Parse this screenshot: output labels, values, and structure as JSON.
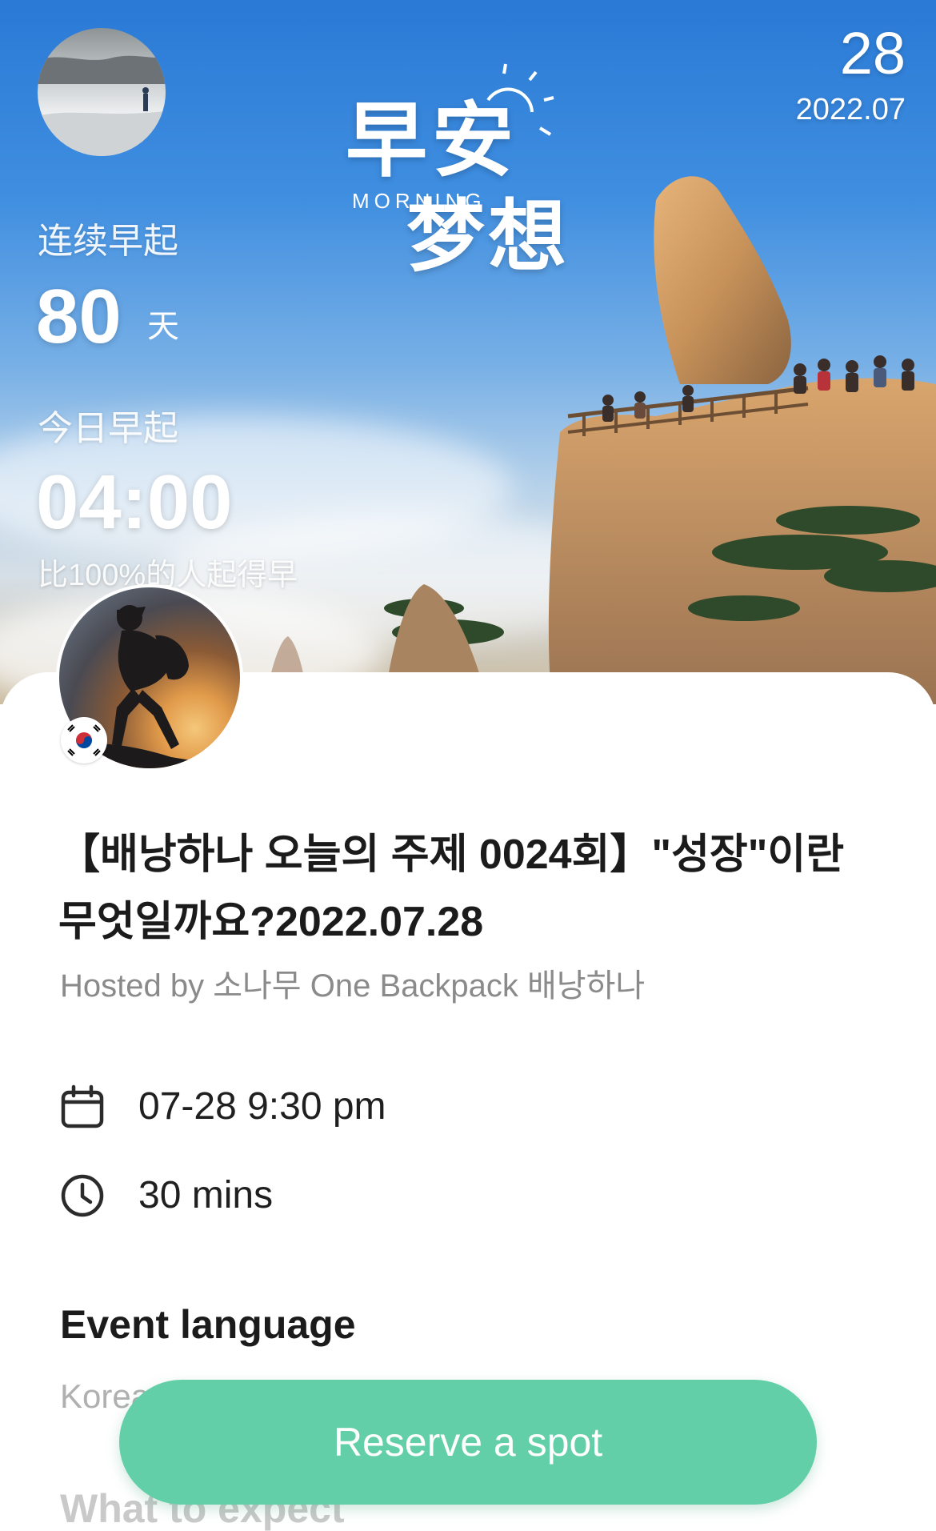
{
  "hero": {
    "date_day": "28",
    "date_month": "2022.07",
    "logo_cn_top": "早安",
    "logo_en": "MORNING",
    "logo_cn_bottom": "梦想",
    "streak_label": "连续早起",
    "streak_value": "80",
    "streak_unit": "天",
    "today_label": "今日早起",
    "today_time": "04:00",
    "ranking_text": "比100%的人起得早"
  },
  "event": {
    "title": "【배낭하나 오늘의 주제 0024회】\"성장\"이란 무엇일까요?2022.07.28",
    "hosted_by": "Hosted by 소나무 One Backpack 배낭하나",
    "date_time": "07-28 9:30 pm",
    "duration": "30 mins",
    "language_heading": "Event language",
    "language_value": "Korean",
    "expect_heading": "What to expect"
  },
  "actions": {
    "reserve_label": "Reserve a spot"
  },
  "colors": {
    "accent": "#63cfa9",
    "title": "#1b1b1b",
    "muted": "#8a8a8a"
  },
  "icons": {
    "date": "calendar-icon",
    "duration": "clock-icon",
    "flag": "korea-flag-icon"
  }
}
